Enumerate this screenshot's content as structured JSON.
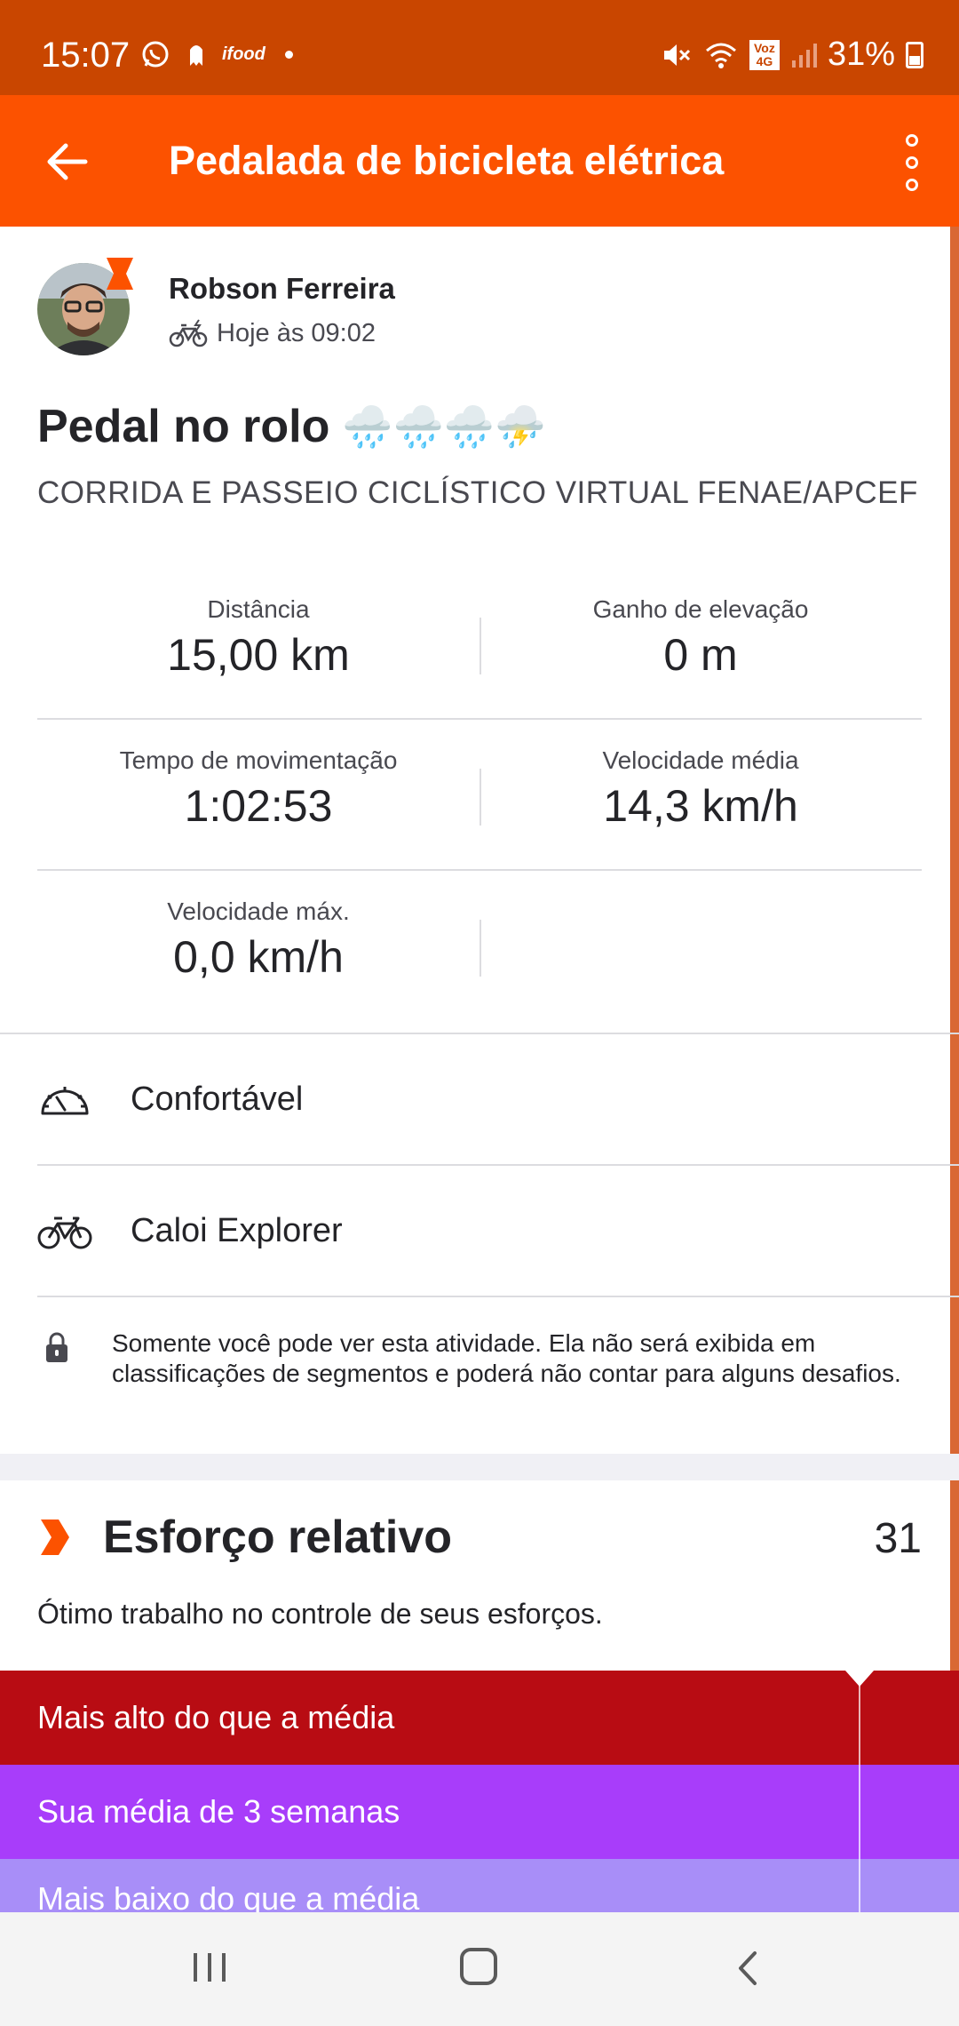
{
  "status_bar": {
    "time": "15:07",
    "left_icons": [
      "whatsapp-icon",
      "ghost-icon",
      "ifood-icon",
      "dot-icon"
    ],
    "ifood_label": "ifood",
    "network_label": "Voz 4G",
    "battery": "31%",
    "battery_level": 0.31
  },
  "app_bar": {
    "title": "Pedalada de bicicleta elétrica",
    "back_icon": "arrow-left-icon",
    "menu_icon": "more-vertical-icon"
  },
  "athlete": {
    "name": "Robson Ferreira",
    "time": "Hoje às 09:02",
    "activity_icon": "ebike-icon"
  },
  "activity": {
    "title": "Pedal no rolo",
    "emojis": "🌧️🌧️🌧️⛈️",
    "subtitle": "CORRIDA E PASSEIO CICLÍSTICO VIRTUAL FENAE/APCEF"
  },
  "stats": [
    {
      "label": "Distância",
      "value": "15,00 km"
    },
    {
      "label": "Ganho de elevação",
      "value": "0 m"
    },
    {
      "label": "Tempo de movimentação",
      "value": "1:02:53"
    },
    {
      "label": "Velocidade média",
      "value": "14,3 km/h"
    },
    {
      "label": "Velocidade máx.",
      "value": "0,0 km/h"
    }
  ],
  "details": {
    "perceived_effort": "Confortável",
    "gear": "Caloi Explorer"
  },
  "privacy_note": "Somente você pode ver esta atividade. Ela não será exibida em classificações de segmentos e poderá não contar para alguns desafios.",
  "relative_effort": {
    "title": "Esforço relativo",
    "score": "31",
    "description": "Ótimo trabalho no controle de seus esforços.",
    "bands": {
      "high": "Mais alto do que a média",
      "avg": "Sua média de 3 semanas",
      "low": "Mais baixo do que a média"
    }
  },
  "colors": {
    "status_bar": "#c94600",
    "app_bar": "#fc5200",
    "band_high": "#b80c13",
    "band_avg": "#a83dfa",
    "band_low": "#a88ef8"
  }
}
